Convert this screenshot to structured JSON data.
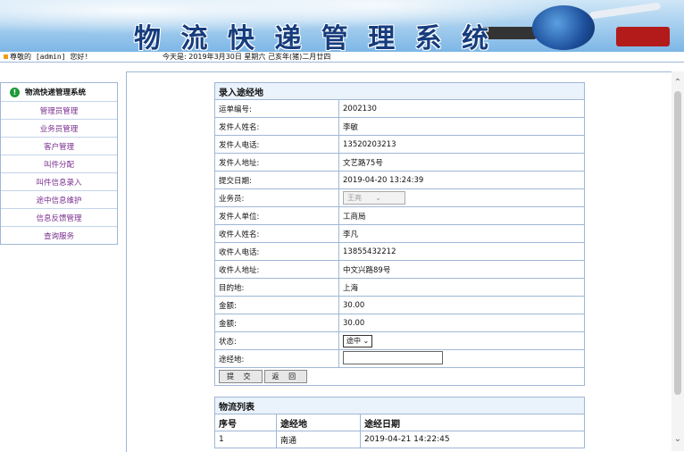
{
  "header": {
    "title": "物 流 快 递 管 理 系 统",
    "welcome": "尊敬的 [admin] 您好!",
    "today": "今天是: 2019年3月30日 星期六 己亥年(猪)二月廿四"
  },
  "sidebar": {
    "heading": "物流快递管理系统",
    "items": [
      {
        "label": "管理员管理"
      },
      {
        "label": "业务员管理"
      },
      {
        "label": "客户管理"
      },
      {
        "label": "叫件分配"
      },
      {
        "label": "叫件信息录入"
      },
      {
        "label": "途中信息维护"
      },
      {
        "label": "信息反馈管理"
      },
      {
        "label": "查询服务"
      }
    ]
  },
  "form": {
    "caption": "录入途经地",
    "rows": [
      {
        "label": "运单编号:",
        "value": "2002130"
      },
      {
        "label": "发件人姓名:",
        "value": "李敏"
      },
      {
        "label": "发件人电话:",
        "value": "13520203213"
      },
      {
        "label": "发件人地址:",
        "value": "文艺路75号"
      },
      {
        "label": "提交日期:",
        "value": "2019-04-20 13:24:39"
      },
      {
        "label": "业务员:",
        "value": "王亮"
      },
      {
        "label": "发件人单位:",
        "value": "工商局"
      },
      {
        "label": "收件人姓名:",
        "value": "李凡"
      },
      {
        "label": "收件人电话:",
        "value": "13855432212"
      },
      {
        "label": "收件人地址:",
        "value": "中文兴路89号"
      },
      {
        "label": "目的地:",
        "value": "上海"
      },
      {
        "label": "金额:",
        "value": "30.00"
      },
      {
        "label": "金额:",
        "value": "30.00"
      },
      {
        "label": "状态:",
        "value": "途中"
      },
      {
        "label": "途经地:",
        "value": ""
      }
    ],
    "submit_label": "提 交",
    "back_label": "返 回"
  },
  "list": {
    "caption": "物流列表",
    "headers": [
      "序号",
      "途经地",
      "途经日期"
    ],
    "rows": [
      [
        "1",
        "南通",
        "2019-04-21 14:22:45"
      ]
    ]
  }
}
